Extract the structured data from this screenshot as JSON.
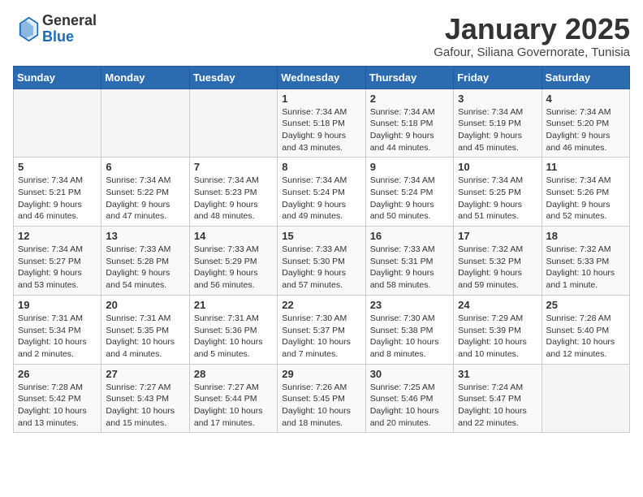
{
  "header": {
    "logo_general": "General",
    "logo_blue": "Blue",
    "month_title": "January 2025",
    "subtitle": "Gafour, Siliana Governorate, Tunisia"
  },
  "columns": [
    "Sunday",
    "Monday",
    "Tuesday",
    "Wednesday",
    "Thursday",
    "Friday",
    "Saturday"
  ],
  "weeks": [
    [
      {
        "day": "",
        "info": ""
      },
      {
        "day": "",
        "info": ""
      },
      {
        "day": "",
        "info": ""
      },
      {
        "day": "1",
        "info": "Sunrise: 7:34 AM\nSunset: 5:18 PM\nDaylight: 9 hours\nand 43 minutes."
      },
      {
        "day": "2",
        "info": "Sunrise: 7:34 AM\nSunset: 5:18 PM\nDaylight: 9 hours\nand 44 minutes."
      },
      {
        "day": "3",
        "info": "Sunrise: 7:34 AM\nSunset: 5:19 PM\nDaylight: 9 hours\nand 45 minutes."
      },
      {
        "day": "4",
        "info": "Sunrise: 7:34 AM\nSunset: 5:20 PM\nDaylight: 9 hours\nand 46 minutes."
      }
    ],
    [
      {
        "day": "5",
        "info": "Sunrise: 7:34 AM\nSunset: 5:21 PM\nDaylight: 9 hours\nand 46 minutes."
      },
      {
        "day": "6",
        "info": "Sunrise: 7:34 AM\nSunset: 5:22 PM\nDaylight: 9 hours\nand 47 minutes."
      },
      {
        "day": "7",
        "info": "Sunrise: 7:34 AM\nSunset: 5:23 PM\nDaylight: 9 hours\nand 48 minutes."
      },
      {
        "day": "8",
        "info": "Sunrise: 7:34 AM\nSunset: 5:24 PM\nDaylight: 9 hours\nand 49 minutes."
      },
      {
        "day": "9",
        "info": "Sunrise: 7:34 AM\nSunset: 5:24 PM\nDaylight: 9 hours\nand 50 minutes."
      },
      {
        "day": "10",
        "info": "Sunrise: 7:34 AM\nSunset: 5:25 PM\nDaylight: 9 hours\nand 51 minutes."
      },
      {
        "day": "11",
        "info": "Sunrise: 7:34 AM\nSunset: 5:26 PM\nDaylight: 9 hours\nand 52 minutes."
      }
    ],
    [
      {
        "day": "12",
        "info": "Sunrise: 7:34 AM\nSunset: 5:27 PM\nDaylight: 9 hours\nand 53 minutes."
      },
      {
        "day": "13",
        "info": "Sunrise: 7:33 AM\nSunset: 5:28 PM\nDaylight: 9 hours\nand 54 minutes."
      },
      {
        "day": "14",
        "info": "Sunrise: 7:33 AM\nSunset: 5:29 PM\nDaylight: 9 hours\nand 56 minutes."
      },
      {
        "day": "15",
        "info": "Sunrise: 7:33 AM\nSunset: 5:30 PM\nDaylight: 9 hours\nand 57 minutes."
      },
      {
        "day": "16",
        "info": "Sunrise: 7:33 AM\nSunset: 5:31 PM\nDaylight: 9 hours\nand 58 minutes."
      },
      {
        "day": "17",
        "info": "Sunrise: 7:32 AM\nSunset: 5:32 PM\nDaylight: 9 hours\nand 59 minutes."
      },
      {
        "day": "18",
        "info": "Sunrise: 7:32 AM\nSunset: 5:33 PM\nDaylight: 10 hours\nand 1 minute."
      }
    ],
    [
      {
        "day": "19",
        "info": "Sunrise: 7:31 AM\nSunset: 5:34 PM\nDaylight: 10 hours\nand 2 minutes."
      },
      {
        "day": "20",
        "info": "Sunrise: 7:31 AM\nSunset: 5:35 PM\nDaylight: 10 hours\nand 4 minutes."
      },
      {
        "day": "21",
        "info": "Sunrise: 7:31 AM\nSunset: 5:36 PM\nDaylight: 10 hours\nand 5 minutes."
      },
      {
        "day": "22",
        "info": "Sunrise: 7:30 AM\nSunset: 5:37 PM\nDaylight: 10 hours\nand 7 minutes."
      },
      {
        "day": "23",
        "info": "Sunrise: 7:30 AM\nSunset: 5:38 PM\nDaylight: 10 hours\nand 8 minutes."
      },
      {
        "day": "24",
        "info": "Sunrise: 7:29 AM\nSunset: 5:39 PM\nDaylight: 10 hours\nand 10 minutes."
      },
      {
        "day": "25",
        "info": "Sunrise: 7:28 AM\nSunset: 5:40 PM\nDaylight: 10 hours\nand 12 minutes."
      }
    ],
    [
      {
        "day": "26",
        "info": "Sunrise: 7:28 AM\nSunset: 5:42 PM\nDaylight: 10 hours\nand 13 minutes."
      },
      {
        "day": "27",
        "info": "Sunrise: 7:27 AM\nSunset: 5:43 PM\nDaylight: 10 hours\nand 15 minutes."
      },
      {
        "day": "28",
        "info": "Sunrise: 7:27 AM\nSunset: 5:44 PM\nDaylight: 10 hours\nand 17 minutes."
      },
      {
        "day": "29",
        "info": "Sunrise: 7:26 AM\nSunset: 5:45 PM\nDaylight: 10 hours\nand 18 minutes."
      },
      {
        "day": "30",
        "info": "Sunrise: 7:25 AM\nSunset: 5:46 PM\nDaylight: 10 hours\nand 20 minutes."
      },
      {
        "day": "31",
        "info": "Sunrise: 7:24 AM\nSunset: 5:47 PM\nDaylight: 10 hours\nand 22 minutes."
      },
      {
        "day": "",
        "info": ""
      }
    ]
  ]
}
